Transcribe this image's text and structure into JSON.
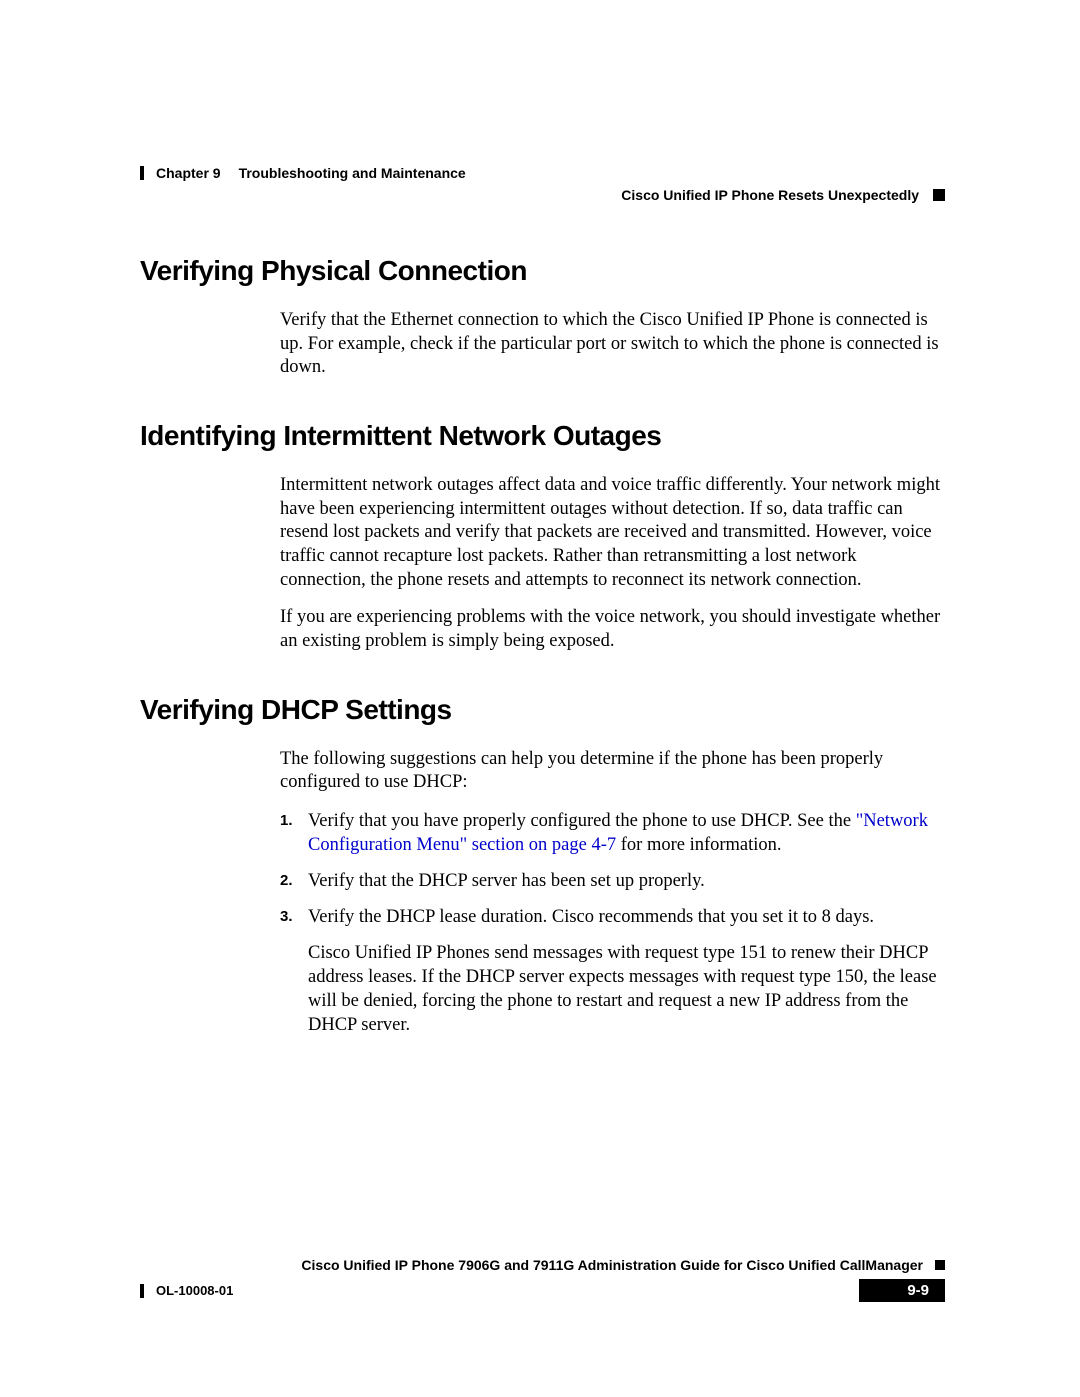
{
  "header": {
    "chapter_label": "Chapter 9",
    "chapter_title": "Troubleshooting and Maintenance",
    "section_ref": "Cisco Unified IP Phone Resets Unexpectedly"
  },
  "sections": [
    {
      "heading": "Verifying Physical Connection",
      "paragraphs": [
        "Verify that the Ethernet connection to which the Cisco Unified IP Phone is connected is up. For example, check if the particular port or switch to which the phone is connected is down."
      ]
    },
    {
      "heading": "Identifying Intermittent Network Outages",
      "paragraphs": [
        "Intermittent network outages affect data and voice traffic differently. Your network might have been experiencing intermittent outages without detection. If so, data traffic can resend lost packets and verify that packets are received and transmitted. However, voice traffic cannot recapture lost packets. Rather than retransmitting a lost network connection, the phone resets and attempts to reconnect its network connection.",
        "If you are experiencing problems with the voice network, you should investigate whether an existing problem is simply being exposed."
      ]
    },
    {
      "heading": "Verifying DHCP Settings",
      "intro": "The following suggestions can help you determine if the phone has been properly configured to use DHCP:",
      "list": [
        {
          "prefix": "Verify that you have properly configured the phone to use DHCP. See the ",
          "link": "\"Network Configuration Menu\" section on page 4-7",
          "suffix": " for more information."
        },
        {
          "text": "Verify that the DHCP server has been set up properly."
        },
        {
          "text": "Verify the DHCP lease duration. Cisco recommends that you set it to 8 days."
        }
      ],
      "post_para": "Cisco Unified IP Phones send messages with request type 151 to renew their DHCP address leases. If the DHCP server expects messages with request type 150, the lease will be denied, forcing the phone to restart and request a new IP address from the DHCP server."
    }
  ],
  "footer": {
    "book_title": "Cisco Unified IP Phone 7906G and 7911G Administration Guide for Cisco Unified CallManager",
    "doc_id": "OL-10008-01",
    "page_num": "9-9"
  }
}
